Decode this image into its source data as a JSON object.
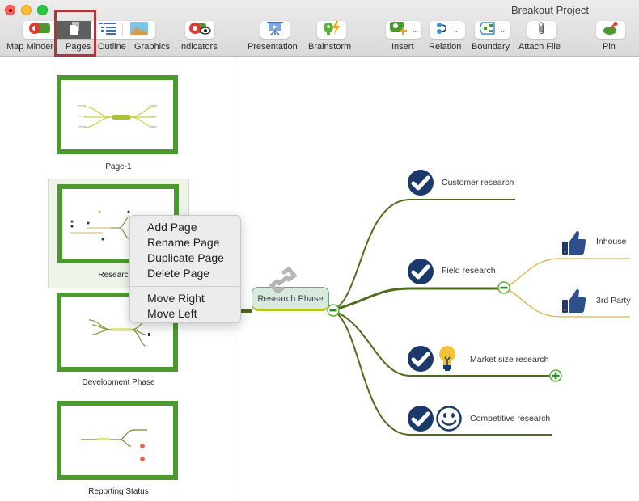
{
  "window": {
    "title": "Breakout Project",
    "controls": [
      "close",
      "minimize",
      "zoom"
    ]
  },
  "toolbar": {
    "view_segments": [
      {
        "label": "Map Minder",
        "icon": "map-minder-icon",
        "active": false
      },
      {
        "label": "Pages",
        "icon": "pages-icon",
        "active": true,
        "highlighted": true
      },
      {
        "label": "Outline",
        "icon": "outline-icon",
        "active": false
      },
      {
        "label": "Graphics",
        "icon": "graphics-icon",
        "active": false
      }
    ],
    "indicators_label": "Indicators",
    "presentation_label": "Presentation",
    "brainstorm_label": "Brainstorm",
    "insert_label": "Insert",
    "relation_label": "Relation",
    "boundary_label": "Boundary",
    "attach_file_label": "Attach File",
    "pin_label": "Pin",
    "highlight_color": "#b3333a"
  },
  "sidebar": {
    "pages": [
      {
        "name": "Page-1",
        "selected": false
      },
      {
        "name": "Research Phase",
        "visible_name": "Research P",
        "selected": true
      },
      {
        "name": "Development Phase",
        "selected": false
      },
      {
        "name": "Reporting Status",
        "selected": false
      }
    ],
    "thumb_border_color": "#4c9a2f"
  },
  "context_menu": {
    "group1": [
      "Add Page",
      "Rename Page",
      "Duplicate Page",
      "Delete Page"
    ],
    "group2": [
      "Move Right",
      "Move Left"
    ]
  },
  "mindmap": {
    "central_topic": "Research Phase",
    "branch_color": "#4f6b1c",
    "sub_branch_color": "#e2b13c",
    "icon_color": "#1b3a6b",
    "topics": [
      {
        "label": "Customer research",
        "icons": [
          "check-icon"
        ]
      },
      {
        "label": "Field research",
        "icons": [
          "check-icon"
        ],
        "collapse": "minus",
        "children": [
          {
            "label": "Inhouse",
            "icons": [
              "thumbs-up-icon"
            ]
          },
          {
            "label": "3rd Party",
            "icons": [
              "thumbs-up-icon"
            ]
          }
        ]
      },
      {
        "label": "Market size research",
        "icons": [
          "check-icon",
          "lightbulb-icon"
        ],
        "collapse": "plus"
      },
      {
        "label": "Competitive research",
        "icons": [
          "check-icon",
          "smiley-icon"
        ]
      }
    ]
  }
}
